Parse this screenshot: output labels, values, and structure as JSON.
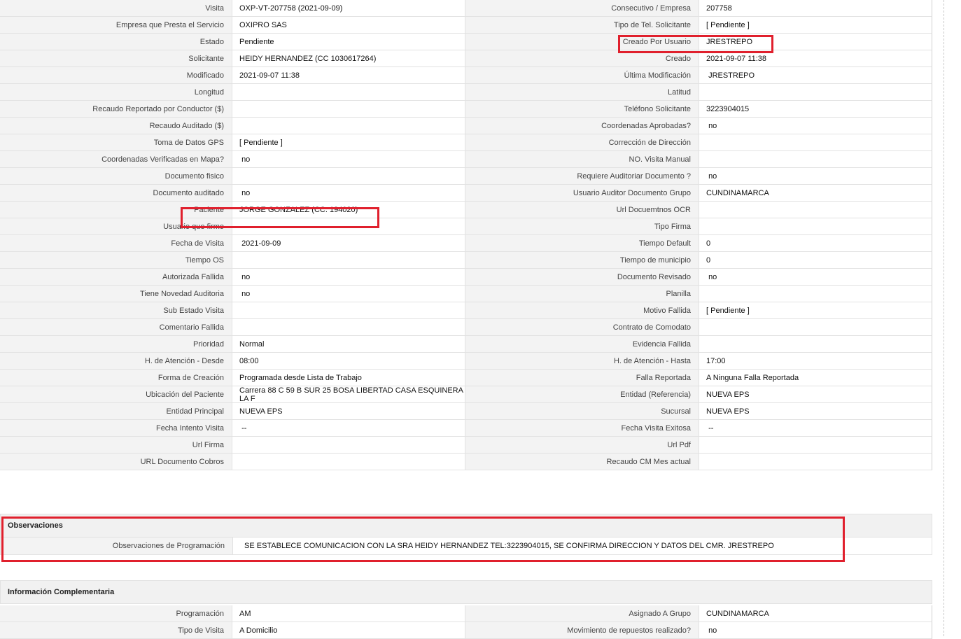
{
  "rows": [
    {
      "l1": "Visita",
      "v1": "OXP-VT-207758 (2021-09-09)",
      "l2": "Consecutivo / Empresa",
      "v2": "207758"
    },
    {
      "l1": "Empresa que Presta el Servicio",
      "v1": "OXIPRO SAS",
      "l2": "Tipo de Tel. Solicitante",
      "v2": "[ Pendiente ]"
    },
    {
      "l1": "Estado",
      "v1": "Pendiente",
      "l2": "Creado Por Usuario",
      "v2": "JRESTREPO"
    },
    {
      "l1": "Solicitante",
      "v1": "HEIDY HERNANDEZ (CC 1030617264)",
      "l2": "Creado",
      "v2": "2021-09-07 11:38"
    },
    {
      "l1": "Modificado",
      "v1": "2021-09-07 11:38",
      "l2": "Última Modificación",
      "v2": " JRESTREPO"
    },
    {
      "l1": "Longitud",
      "v1": "",
      "l2": "Latitud",
      "v2": ""
    },
    {
      "l1": "Recaudo Reportado por Conductor ($)",
      "v1": "",
      "l2": "Teléfono Solicitante",
      "v2": "3223904015"
    },
    {
      "l1": "Recaudo Auditado ($)",
      "v1": "",
      "l2": "Coordenadas Aprobadas?",
      "v2": " no"
    },
    {
      "l1": "Toma de Datos GPS",
      "v1": "[ Pendiente ]",
      "l2": "Corrección de Dirección",
      "v2": ""
    },
    {
      "l1": "Coordenadas Verificadas en Mapa?",
      "v1": " no",
      "l2": "NO. Visita Manual",
      "v2": ""
    },
    {
      "l1": "Documento fisico",
      "v1": "",
      "l2": "Requiere Auditoriar Documento ?",
      "v2": " no"
    },
    {
      "l1": "Documento auditado",
      "v1": " no",
      "l2": "Usuario Auditor Documento Grupo",
      "v2": "CUNDINAMARCA"
    },
    {
      "l1": "Paciente",
      "v1": "JORGE GONZALEZ (CC: 194020)",
      "l2": "Url Docuemtnos OCR",
      "v2": ""
    },
    {
      "l1": "Usuario que firmo",
      "v1": "",
      "l2": "Tipo Firma",
      "v2": ""
    },
    {
      "l1": "Fecha de Visita",
      "v1": " 2021-09-09",
      "l2": "Tiempo Default",
      "v2": "0"
    },
    {
      "l1": "Tiempo OS",
      "v1": "",
      "l2": "Tiempo de municipio",
      "v2": "0"
    },
    {
      "l1": "Autorizada Fallida",
      "v1": " no",
      "l2": "Documento Revisado",
      "v2": " no"
    },
    {
      "l1": "Tiene Novedad Auditoria",
      "v1": " no",
      "l2": "Planilla",
      "v2": ""
    },
    {
      "l1": "Sub Estado Visita",
      "v1": "",
      "l2": "Motivo Fallida",
      "v2": "[ Pendiente ]"
    },
    {
      "l1": "Comentario Fallida",
      "v1": "",
      "l2": "Contrato de Comodato",
      "v2": ""
    },
    {
      "l1": "Prioridad",
      "v1": "Normal",
      "l2": "Evidencia Fallida",
      "v2": ""
    },
    {
      "l1": "H. de Atención - Desde",
      "v1": "08:00",
      "l2": "H. de Atención - Hasta",
      "v2": "17:00"
    },
    {
      "l1": "Forma de Creación",
      "v1": "Programada desde Lista de Trabajo",
      "l2": "Falla Reportada",
      "v2": "A Ninguna Falla Reportada"
    },
    {
      "l1": "Ubicación del Paciente",
      "v1": "Carrera 88 C 59 B SUR 25 BOSA LIBERTAD CASA ESQUINERA LA F",
      "l2": "Entidad (Referencia)",
      "v2": "NUEVA EPS"
    },
    {
      "l1": "Entidad Principal",
      "v1": "NUEVA EPS",
      "l2": "Sucursal",
      "v2": "NUEVA EPS"
    },
    {
      "l1": "Fecha Intento Visita",
      "v1": " --",
      "l2": "Fecha Visita Exitosa",
      "v2": " --"
    },
    {
      "l1": "Url Firma",
      "v1": "",
      "l2": "Url Pdf",
      "v2": ""
    },
    {
      "l1": "URL Documento Cobros",
      "v1": "",
      "l2": "Recaudo CM Mes actual",
      "v2": ""
    }
  ],
  "observaciones": {
    "title": "Observaciones",
    "label": "Observaciones de Programación",
    "value": "SE ESTABLECE COMUNICACION CON LA SRA HEIDY HERNANDEZ TEL:3223904015, SE CONFIRMA DIRECCION Y DATOS DEL CMR. JRESTREPO"
  },
  "complementaria": {
    "title": "Información Complementaria",
    "rows": [
      {
        "l1": "Programación",
        "v1": "AM",
        "l2": "Asignado A Grupo",
        "v2": "CUNDINAMARCA"
      },
      {
        "l1": "Tipo de Visita",
        "v1": "A Domicilio",
        "l2": "Movimiento de repuestos realizado?",
        "v2": " no"
      }
    ]
  },
  "highlight_color": "#e0202d"
}
